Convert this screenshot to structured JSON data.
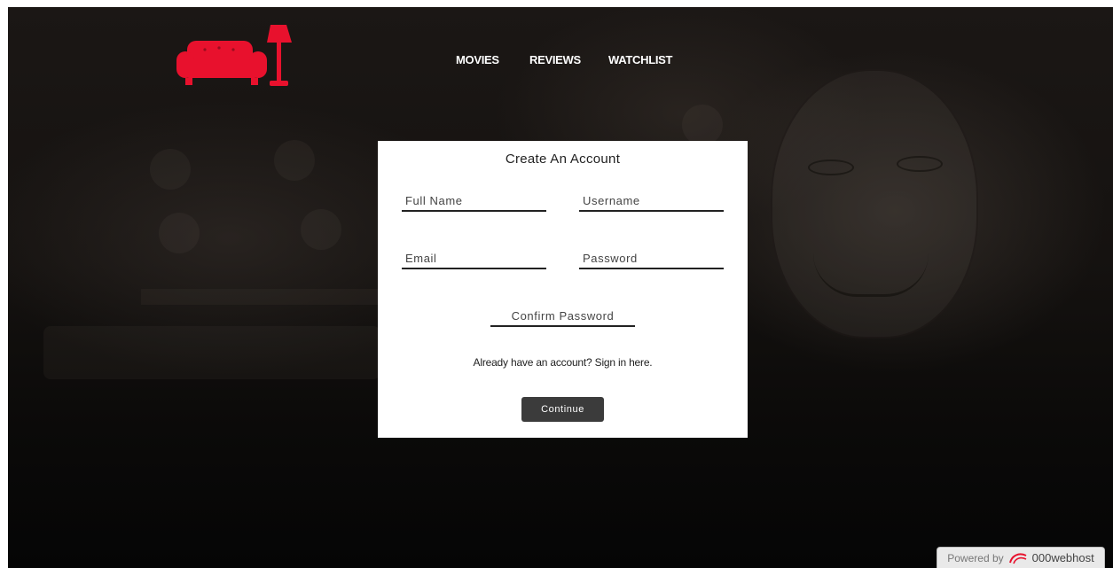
{
  "header": {
    "logo_icon": "sofa-lamp-logo-icon",
    "brand_color": "#e8112d",
    "nav": [
      {
        "label": "MOVIES"
      },
      {
        "label": "REVIEWS"
      },
      {
        "label": "WATCHLIST"
      }
    ]
  },
  "form": {
    "title": "Create An Account",
    "fields": {
      "full_name": {
        "placeholder": "Full Name",
        "value": ""
      },
      "username": {
        "placeholder": "Username",
        "value": ""
      },
      "email": {
        "placeholder": "Email",
        "value": ""
      },
      "password": {
        "placeholder": "Password",
        "value": ""
      },
      "confirm_password": {
        "placeholder": "Confirm Password",
        "value": ""
      }
    },
    "signin_prompt": "Already have an account?",
    "signin_link": "Sign in here.",
    "continue_label": "Continue",
    "button_color": "#3b3b3b"
  },
  "footer": {
    "powered_by": "Powered by",
    "brand_icon": "000webhost-swirl-icon",
    "brand": "000webhost"
  }
}
